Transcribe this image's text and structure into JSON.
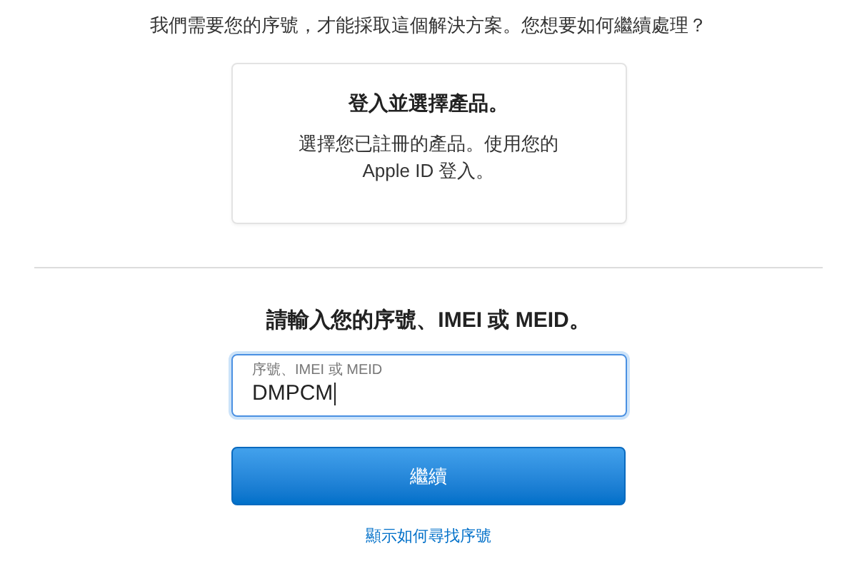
{
  "intro": "我們需要您的序號，才能採取這個解決方案。您想要如何繼續處理？",
  "sign_in_card": {
    "title": "登入並選擇產品。",
    "description_lines": [
      "選擇您已註冊的產品。使用您的",
      "Apple ID 登入。"
    ]
  },
  "serial_section": {
    "heading": "請輸入您的序號、IMEI 或 MEID。",
    "field": {
      "label": "序號、IMEI 或 MEID",
      "value": "DMPCM",
      "focused": true
    },
    "button": "繼續",
    "help_link": "顯示如何尋找序號"
  }
}
